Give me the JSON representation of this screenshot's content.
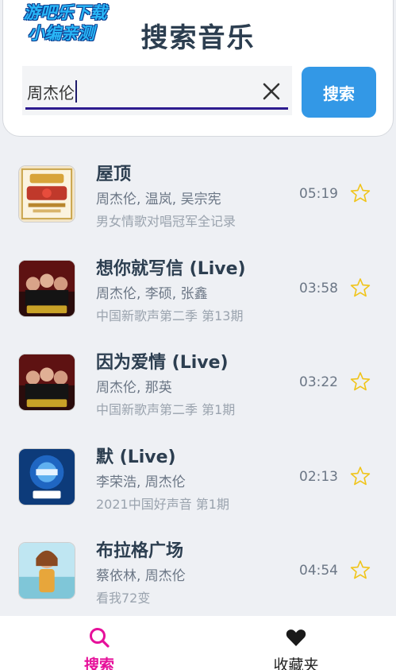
{
  "watermark": {
    "line1": "游吧乐下载",
    "line2": "小编亲测"
  },
  "header": {
    "title": "搜索音乐"
  },
  "search": {
    "value": "周杰伦",
    "button_label": "搜索"
  },
  "results": [
    {
      "title": "屋顶",
      "artists": "周杰伦, 温岚, 吴宗宪",
      "album": "男女情歌对唱冠军全记录",
      "duration": "05:19"
    },
    {
      "title": "想你就写信 (Live)",
      "artists": "周杰伦, 李硕, 张鑫",
      "album": "中国新歌声第二季 第13期",
      "duration": "03:58"
    },
    {
      "title": "因为爱情 (Live)",
      "artists": "周杰伦, 那英",
      "album": "中国新歌声第二季 第1期",
      "duration": "03:22"
    },
    {
      "title": "默 (Live)",
      "artists": "李荣浩, 周杰伦",
      "album": "2021中国好声音 第1期",
      "duration": "02:13"
    },
    {
      "title": "布拉格广场",
      "artists": "蔡依林, 周杰伦",
      "album": "看我72变",
      "duration": "04:54"
    }
  ],
  "nav": {
    "search_label": "搜索",
    "favorites_label": "收藏夹"
  },
  "colors": {
    "accent": "#3398e6",
    "active_tab": "#e6109a",
    "star": "#f0c419",
    "title": "#2c3e50"
  }
}
